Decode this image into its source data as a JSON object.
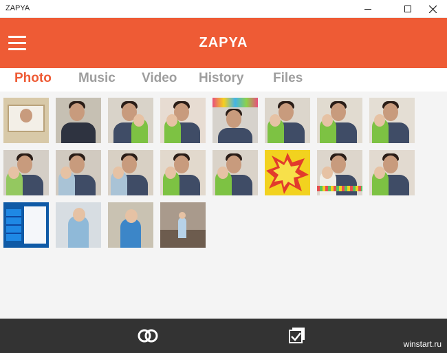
{
  "window": {
    "title": "ZAPYA"
  },
  "app": {
    "title": "ZAPYA"
  },
  "tabs": [
    {
      "label": "Photo",
      "active": true
    },
    {
      "label": "Music",
      "active": false
    },
    {
      "label": "Video",
      "active": false
    },
    {
      "label": "History",
      "active": false
    },
    {
      "label": "Files",
      "active": false
    }
  ],
  "colors": {
    "accent": "#ee5b35",
    "bottom_bar": "#333333",
    "inactive_tab": "#9e9e9e"
  },
  "photos_count": 20,
  "bottom_bar": {
    "left_icon": "link-icon",
    "right_icon": "multi-select-icon"
  },
  "watermark": "winstart.ru"
}
